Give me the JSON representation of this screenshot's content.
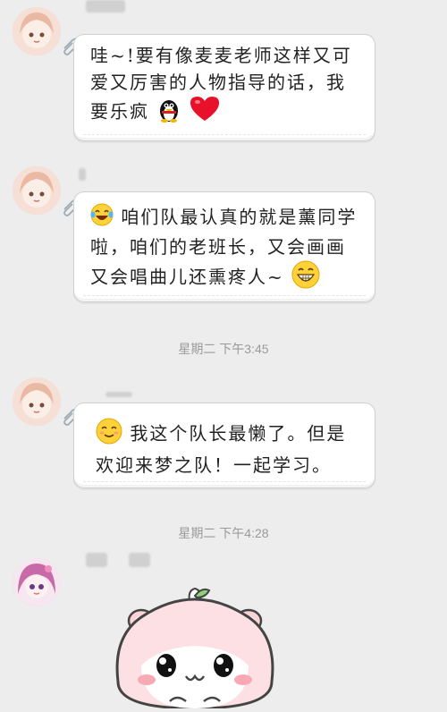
{
  "messages": [
    {
      "text_before": "哇~!要有像麦麦老师这样又可爱又厉害的人物指导的话，我要乐疯",
      "emojis": [
        "penguin-icon",
        "red-heart-icon"
      ]
    },
    {
      "text": "咱们队最认真的就是薰同学啦，咱们的老班长，又会画画又会唱曲儿还熏疼人~",
      "emojis": [
        "laughing-tears-icon",
        "grinning-face-icon"
      ]
    },
    {
      "text": "我这个队长最懒了。但是欢迎来梦之队！一起学习。",
      "emojis": [
        "smiling-face-icon"
      ]
    }
  ],
  "timestamps": [
    "星期二 下午3:45",
    "星期二 下午4:28"
  ],
  "sticker": {
    "icon": "hamster-sticker-icon"
  },
  "colors": {
    "background": "#ededed",
    "bubble": "#ffffff",
    "timestamp": "#9a9a9a"
  }
}
